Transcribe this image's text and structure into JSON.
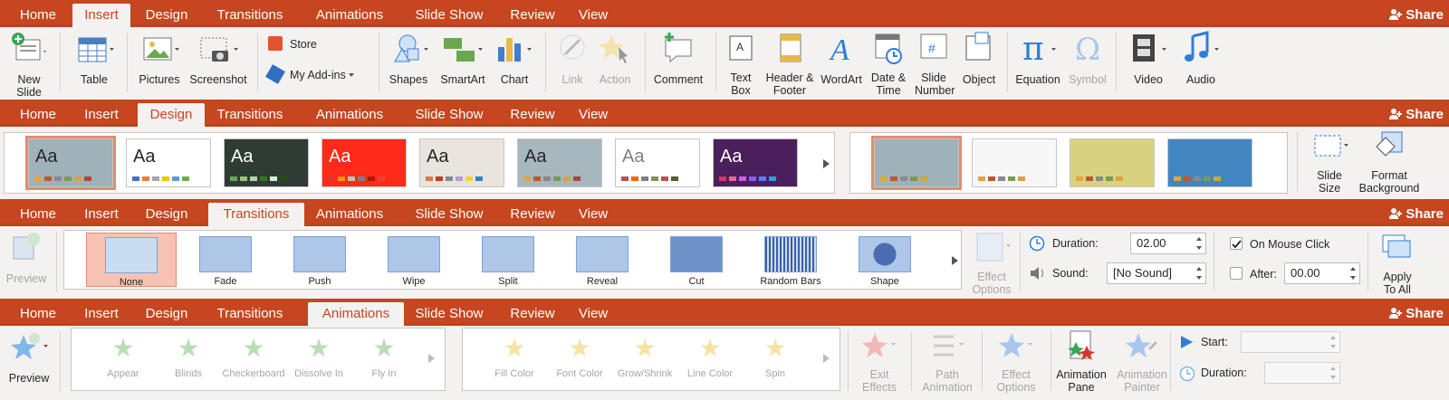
{
  "tabs": [
    "Home",
    "Insert",
    "Design",
    "Transitions",
    "Animations",
    "Slide Show",
    "Review",
    "View"
  ],
  "share_label": "Share",
  "insert": {
    "new_slide": "New Slide",
    "table": "Table",
    "pictures": "Pictures",
    "screenshot": "Screenshot",
    "store": "Store",
    "my_addins": "My Add-ins",
    "shapes": "Shapes",
    "smartart": "SmartArt",
    "chart": "Chart",
    "link": "Link",
    "action": "Action",
    "comment": "Comment",
    "text_box": "Text Box",
    "header_footer": "Header & Footer",
    "wordart": "WordArt",
    "date_time": "Date & Time",
    "slide_number": "Slide Number",
    "object": "Object",
    "equation": "Equation",
    "symbol": "Symbol",
    "video": "Video",
    "audio": "Audio"
  },
  "design": {
    "theme_text": "Aa",
    "themes": [
      {
        "bg": "#9fb1b9",
        "fg": "#262626",
        "dots": [
          "#e7a33a",
          "#c4552b",
          "#8a8a8a",
          "#7a9c4e",
          "#d8a23e",
          "#b1433a"
        ]
      },
      {
        "bg": "#ffffff",
        "fg": "#262626",
        "dots": [
          "#4472c4",
          "#ed7d31",
          "#a5a5a5",
          "#ffc000",
          "#5b9bd5",
          "#70ad47"
        ]
      },
      {
        "bg": "#2f3b35",
        "fg": "#ffffff",
        "dots": [
          "#6aa84f",
          "#93c47d",
          "#b6d7a8",
          "#38761d",
          "#d9ead3",
          "#274e13"
        ]
      },
      {
        "bg": "#ff2a1a",
        "fg": "#ffffff",
        "dots": [
          "#e6332a",
          "#f29500",
          "#c0c0c0",
          "#7f7f7f",
          "#a61c00",
          "#ea4335"
        ]
      },
      {
        "bg": "#e9e4dd",
        "fg": "#262626",
        "dots": [
          "#e07b39",
          "#c0392b",
          "#7f8c8d",
          "#b39ddb",
          "#f4d03f",
          "#2e86c1"
        ]
      },
      {
        "bg": "#a7b7bf",
        "fg": "#262626",
        "dots": [
          "#e7a33a",
          "#c4552b",
          "#8a8a8a",
          "#7a9c4e",
          "#d8a23e",
          "#b1433a"
        ]
      },
      {
        "bg": "#ffffff",
        "fg": "#7f7f7f",
        "dots": [
          "#c0504d",
          "#e46c0a",
          "#7f7f7f",
          "#948a54",
          "#c0504d",
          "#4f6228"
        ]
      },
      {
        "bg": "#4a1f5c",
        "fg": "#ffffff",
        "dots": [
          "#d6336c",
          "#f06595",
          "#cc5de8",
          "#845ef7",
          "#5c7cfa",
          "#339af0"
        ]
      }
    ],
    "variants": [
      {
        "bg": "#9fb1b9"
      },
      {
        "bg": "#f7f7f7"
      },
      {
        "bg": "#d8d280"
      },
      {
        "bg": "#4186c0"
      }
    ],
    "slide_size": "Slide Size",
    "format_background": "Format Background"
  },
  "transitions": {
    "preview": "Preview",
    "items": [
      "None",
      "Fade",
      "Push",
      "Wipe",
      "Split",
      "Reveal",
      "Cut",
      "Random Bars",
      "Shape"
    ],
    "effect_options": "Effect Options",
    "duration_label": "Duration:",
    "duration_value": "02.00",
    "sound_label": "Sound:",
    "sound_value": "[No Sound]",
    "on_mouse_click": "On Mouse Click",
    "after_label": "After:",
    "after_value": "00.00",
    "apply_to_all": "Apply To All"
  },
  "animations": {
    "preview": "Preview",
    "entrance": [
      "Appear",
      "Blinds",
      "Checkerboard",
      "Dissolve In",
      "Fly In"
    ],
    "emphasis": [
      "Fill Color",
      "Font Color",
      "Grow/Shrink",
      "Line Color",
      "Spin"
    ],
    "exit_effects": "Exit Effects",
    "path_animation": "Path Animation",
    "effect_options": "Effect Options",
    "animation_pane": "Animation Pane",
    "animation_painter": "Animation Painter",
    "start_label": "Start:",
    "duration_label": "Duration:"
  },
  "colors": {
    "accent": "#c5461f",
    "selected": "#f7c2b3",
    "blue_icon": "#2f7ed8"
  }
}
